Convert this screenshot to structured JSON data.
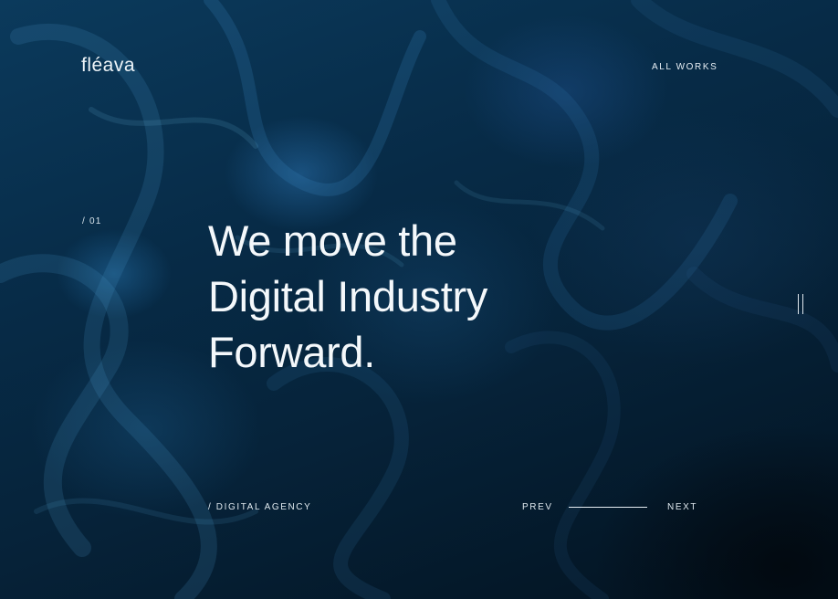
{
  "brand": {
    "logo_text": "fléava"
  },
  "nav": {
    "all_works_label": "ALL WORKS"
  },
  "slide": {
    "index_label": "/ 01",
    "headline_lines": [
      "We move the",
      "Digital Industry",
      "Forward."
    ],
    "tagline": "/ DIGITAL AGENCY"
  },
  "slider_controls": {
    "prev_label": "PREV",
    "next_label": "NEXT",
    "progress_fraction": 1.0,
    "pause_icon": "pause-icon"
  },
  "colors": {
    "text": "#e6eef4",
    "background_dark": "#03101c",
    "accent_blue": "#0b3a5c"
  }
}
